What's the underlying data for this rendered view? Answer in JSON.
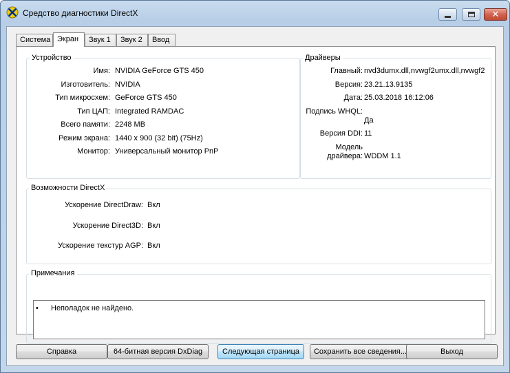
{
  "window": {
    "title": "Средство диагностики DirectX"
  },
  "tabs": [
    {
      "label": "Система"
    },
    {
      "label": "Экран"
    },
    {
      "label": "Звук 1"
    },
    {
      "label": "Звук 2"
    },
    {
      "label": "Ввод"
    }
  ],
  "device": {
    "title": "Устройство",
    "rows": [
      {
        "label": "Имя:",
        "value": "NVIDIA GeForce GTS 450"
      },
      {
        "label": "Изготовитель:",
        "value": "NVIDIA"
      },
      {
        "label": "Тип микросхем:",
        "value": "GeForce GTS 450"
      },
      {
        "label": "Тип ЦАП:",
        "value": "Integrated RAMDAC"
      },
      {
        "label": "Всего памяти:",
        "value": "2248 MB"
      },
      {
        "label": "Режим экрана:",
        "value": "1440 x 900 (32 bit) (75Hz)"
      },
      {
        "label": "Монитор:",
        "value": "Универсальный монитор PnP"
      }
    ]
  },
  "drivers": {
    "title": "Драйверы",
    "main_label": "Главный:",
    "main_value": "nvd3dumx.dll,nvwgf2umx.dll,nvwgf2",
    "version_label": "Версия:",
    "version_value": "23.21.13.9135",
    "date_label": "Дата:",
    "date_value": "25.03.2018 16:12:06",
    "whql_label": "Подпись WHQL:",
    "whql_value": "Да",
    "ddi_label": "Версия DDI:",
    "ddi_value": "11",
    "model_label_1": "Модель",
    "model_label_2": "драйвера:",
    "model_value": "WDDM 1.1"
  },
  "directx": {
    "title": "Возможности DirectX",
    "rows": [
      {
        "label": "Ускорение DirectDraw:",
        "value": "Вкл"
      },
      {
        "label": "Ускорение Direct3D:",
        "value": "Вкл"
      },
      {
        "label": "Ускорение текстур AGP:",
        "value": "Вкл"
      }
    ]
  },
  "notes": {
    "title": "Примечания",
    "bullet": "•",
    "text": "Неполадок не найдено."
  },
  "buttons": {
    "help": "Справка",
    "bit64": "64-битная версия DxDiag",
    "next": "Следующая страница",
    "save": "Сохранить все сведения...",
    "exit": "Выход"
  },
  "icons": {
    "app": "directx-icon",
    "minimize": "minimize-icon",
    "maximize": "maximize-icon",
    "close": "close-icon"
  },
  "colors": {
    "titlebar": "#b7cee6",
    "close_button": "#c04a35",
    "focused_button": "#bee6fd",
    "icon_yellow": "#f4d000",
    "icon_blue": "#1f5fbf"
  }
}
